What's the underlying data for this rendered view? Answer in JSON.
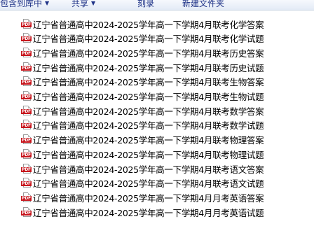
{
  "toolbar": {
    "items": [
      {
        "label": "包含到库中",
        "has_dropdown": true
      },
      {
        "label": "共享",
        "has_dropdown": true
      },
      {
        "label": "刻录",
        "has_dropdown": false
      },
      {
        "label": "新建文件夹",
        "has_dropdown": false
      }
    ]
  },
  "file_icon": {
    "type": "pdf-file-icon",
    "badge": "PDF",
    "badge_color": "#c8161d"
  },
  "files": [
    "辽宁省普通高中2024-2025学年高一下学期4月联考化学答案",
    "辽宁省普通高中2024-2025学年高一下学期4月联考化学试题",
    "辽宁省普通高中2024-2025学年高一下学期4月联考历史答案",
    "辽宁省普通高中2024-2025学年高一下学期4月联考历史试题",
    "辽宁省普通高中2024-2025学年高一下学期4月联考生物答案",
    "辽宁省普通高中2024-2025学年高一下学期4月联考生物试题",
    "辽宁省普通高中2024-2025学年高一下学期4月联考数学答案",
    "辽宁省普通高中2024-2025学年高一下学期4月联考数学试题",
    "辽宁省普通高中2024-2025学年高一下学期4月联考物理答案",
    "辽宁省普通高中2024-2025学年高一下学期4月联考物理试题",
    "辽宁省普通高中2024-2025学年高一下学期4月联考语文答案",
    "辽宁省普通高中2024-2025学年高一下学期4月联考语文试题",
    "辽宁省普通高中2024-2025学年高一下学期4月月考英语答案",
    "辽宁省普通高中2024-2025学年高一下学期4月月考英语试题"
  ]
}
